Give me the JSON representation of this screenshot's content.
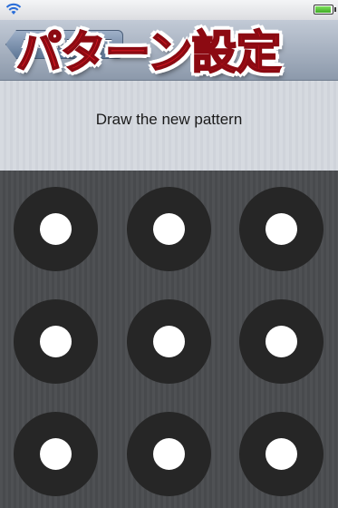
{
  "status_bar": {
    "wifi_icon": "wifi-icon",
    "battery_icon": "battery-icon",
    "battery_level": 0.9,
    "battery_color": "#3eaa24"
  },
  "nav": {
    "back_label": "AndroidLock XT",
    "overlay_title": "パターン設定",
    "overlay_color": "#e21a26"
  },
  "instruction": "Draw the new pattern",
  "pattern": {
    "rows": 3,
    "cols": 3,
    "dot_color": "#262626",
    "center_color": "#ffffff"
  }
}
